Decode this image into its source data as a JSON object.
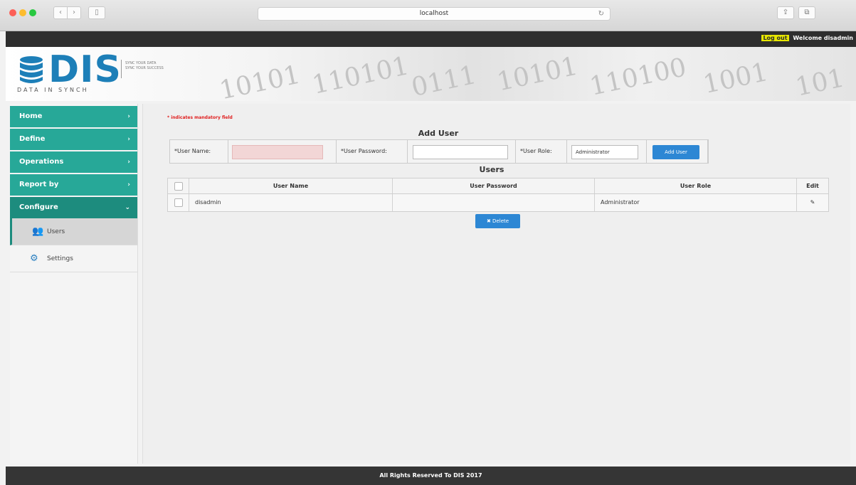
{
  "browser": {
    "url": "localhost"
  },
  "topbar": {
    "logout_label": "Log out",
    "welcome_text": "Welcome disadmin"
  },
  "logo": {
    "main": "DIS",
    "sub": "DATA IN SYNCH",
    "tagline_1": "SYNC YOUR DATA",
    "tagline_2": "SYNC YOUR SUCCESS"
  },
  "sidebar": {
    "items": [
      {
        "label": "Home",
        "icon": "chevron-right-icon"
      },
      {
        "label": "Define",
        "icon": "chevron-right-icon"
      },
      {
        "label": "Operations",
        "icon": "chevron-right-icon"
      },
      {
        "label": "Report by",
        "icon": "chevron-right-icon"
      },
      {
        "label": "Configure",
        "icon": "chevron-down-icon"
      }
    ],
    "subitems": [
      {
        "label": "Users",
        "icon": "users-icon"
      },
      {
        "label": "Settings",
        "icon": "gears-icon"
      }
    ]
  },
  "main": {
    "mandatory_note": "* indicates mandatory field",
    "add_user_title": "Add User",
    "add_user_form": {
      "username_label": "*User Name:",
      "username_value": "",
      "password_label": "*User Password:",
      "password_value": "",
      "role_label": "*User Role:",
      "role_value": "Administrator",
      "add_button": "Add User"
    },
    "users_title": "Users",
    "table": {
      "headers": [
        "User Name",
        "User Password",
        "User Role",
        "Edit"
      ],
      "rows": [
        {
          "user_name": "disadmin",
          "user_password": "",
          "user_role": "Administrator",
          "edit_icon": "pencil-icon"
        }
      ]
    },
    "delete_button": "Delete"
  },
  "footer": {
    "text": "All Rights Reserved To DIS 2017"
  },
  "colors": {
    "sidebar_teal": "#27a898",
    "sidebar_active": "#1d8c7e",
    "button_blue": "#2d87d4",
    "logo_blue": "#1d7fb8",
    "mandatory_red": "#e02020"
  }
}
